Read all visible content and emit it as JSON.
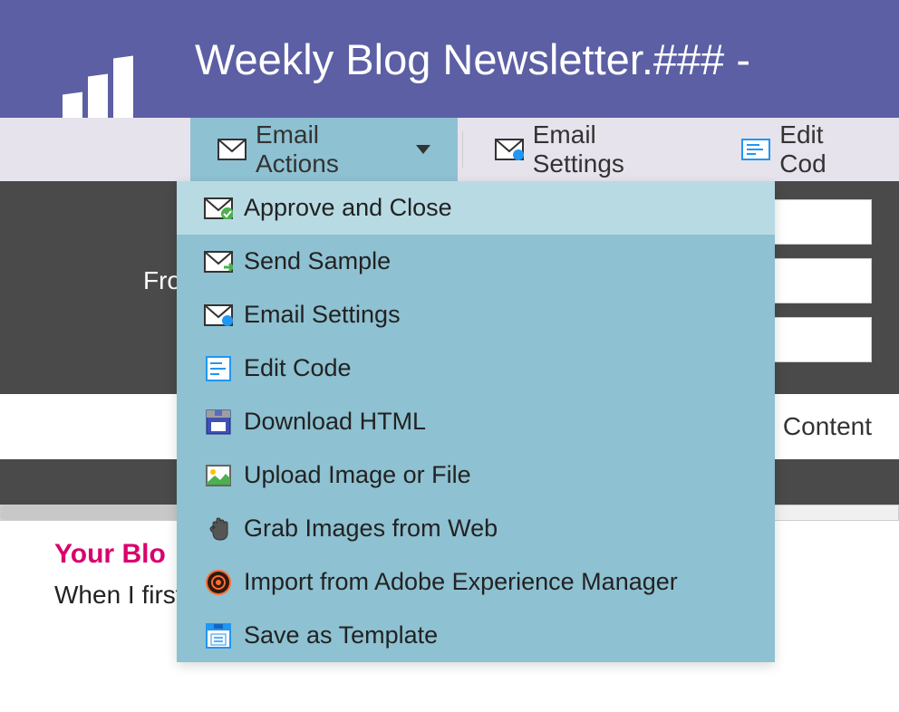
{
  "header": {
    "title": "Weekly Blog Newsletter.### -"
  },
  "toolbar": {
    "emailActions": "Email Actions",
    "emailSettings": "Email Settings",
    "editCode": "Edit Cod"
  },
  "dropdown": {
    "items": [
      {
        "label": "Approve and Close",
        "icon": "approve"
      },
      {
        "label": "Send Sample",
        "icon": "send"
      },
      {
        "label": "Email Settings",
        "icon": "settings"
      },
      {
        "label": "Edit Code",
        "icon": "code"
      },
      {
        "label": "Download HTML",
        "icon": "download"
      },
      {
        "label": "Upload Image or File",
        "icon": "upload"
      },
      {
        "label": "Grab Images from Web",
        "icon": "grab"
      },
      {
        "label": "Import from Adobe Experience Manager",
        "icon": "adobe"
      },
      {
        "label": "Save as Template",
        "icon": "save"
      }
    ]
  },
  "form": {
    "fromLabel": "Fro",
    "contentLabel": "Content"
  },
  "blog": {
    "heading": "Your Blo",
    "body": "When I first joined FeedOtter, the first task I was given was u"
  }
}
